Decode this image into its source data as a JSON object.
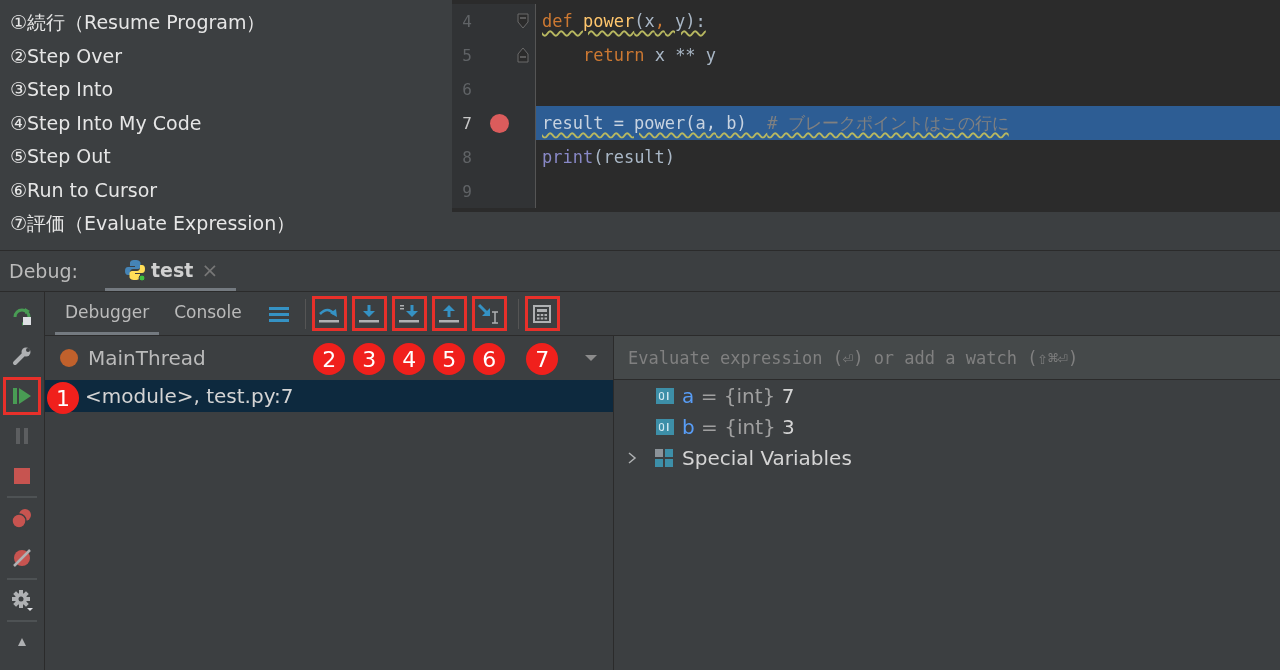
{
  "notes": [
    "①続行（Resume Program）",
    "②Step Over",
    "③Step Into",
    "④Step Into My Code",
    "⑤Step Out",
    "⑥Run to Cursor",
    "⑦評価（Evaluate Expression）"
  ],
  "editor": {
    "lines": [
      {
        "number": "4",
        "breakpoint": false,
        "highlighted": false,
        "warning": true,
        "fold_start": true,
        "fold_end": false,
        "indented": false,
        "tokens": [
          {
            "kind": "keyword",
            "text": "def "
          },
          {
            "kind": "function",
            "text": "power"
          },
          {
            "kind": "plain",
            "text": "(x"
          },
          {
            "kind": "punct",
            "text": ","
          },
          {
            "kind": "plain",
            "text": " y):"
          }
        ]
      },
      {
        "number": "5",
        "breakpoint": false,
        "highlighted": false,
        "warning": false,
        "fold_start": false,
        "fold_end": true,
        "indented": true,
        "tokens": [
          {
            "kind": "keyword",
            "text": "return"
          },
          {
            "kind": "plain",
            "text": " x ** y"
          }
        ]
      },
      {
        "number": "6",
        "breakpoint": false,
        "highlighted": false,
        "fold_start": false,
        "fold_end": false
      },
      {
        "number": "7",
        "breakpoint": true,
        "highlighted": true,
        "warning": true,
        "fold_start": false,
        "fold_end": false,
        "indented": false,
        "tokens": [
          {
            "kind": "plain",
            "text": "result = power(a"
          },
          {
            "kind": "punct",
            "text": ","
          },
          {
            "kind": "plain",
            "text": " b)  "
          },
          {
            "kind": "comment",
            "text": "# ブレークポイントはこの行に"
          }
        ]
      },
      {
        "number": "8",
        "breakpoint": false,
        "highlighted": false,
        "warning": false,
        "fold_start": false,
        "fold_end": false,
        "indented": false,
        "tokens": [
          {
            "kind": "builtin",
            "text": "print"
          },
          {
            "kind": "plain",
            "text": "(result)"
          }
        ]
      },
      {
        "number": "9",
        "breakpoint": false,
        "highlighted": false,
        "fold_start": false,
        "fold_end": false
      }
    ]
  },
  "debug_bar": {
    "label": "Debug:",
    "tab": {
      "title": "test",
      "close": "×"
    }
  },
  "side_toolbar": [
    {
      "kind": "rerun"
    },
    {
      "kind": "settings_wrench"
    },
    {
      "kind": "resume",
      "callout": "1"
    },
    {
      "kind": "pause"
    },
    {
      "kind": "stop"
    },
    {
      "kind": "separator"
    },
    {
      "kind": "breakpoints"
    },
    {
      "kind": "mute"
    },
    {
      "kind": "separator"
    },
    {
      "kind": "gear"
    },
    {
      "kind": "separator"
    },
    {
      "kind": "pin"
    }
  ],
  "tabs": [
    {
      "label": "Debugger",
      "selected": true
    },
    {
      "label": "Console",
      "selected": false
    }
  ],
  "step_buttons": [
    {
      "kind": "step_over",
      "callout": "2"
    },
    {
      "kind": "step_into",
      "callout": "3"
    },
    {
      "kind": "step_into_my_code",
      "callout": "4"
    },
    {
      "kind": "step_out",
      "callout": "5"
    },
    {
      "kind": "run_to_cursor",
      "callout": "6"
    },
    {
      "kind": "separator"
    },
    {
      "kind": "evaluate",
      "callout": "7"
    }
  ],
  "thread": {
    "name": "MainThread"
  },
  "frames": [
    {
      "label": "<module>, test.py:7",
      "selected": true
    }
  ],
  "watch": {
    "placeholder": "Evaluate expression (⏎) or add a watch (⇧⌘⏎)"
  },
  "variables": [
    {
      "kind": "value",
      "name": "a",
      "operator": "=",
      "type": "{int}",
      "value": "7"
    },
    {
      "kind": "value",
      "name": "b",
      "operator": "=",
      "type": "{int}",
      "value": "3"
    },
    {
      "kind": "group",
      "name": "Special Variables",
      "expanded": false
    }
  ]
}
